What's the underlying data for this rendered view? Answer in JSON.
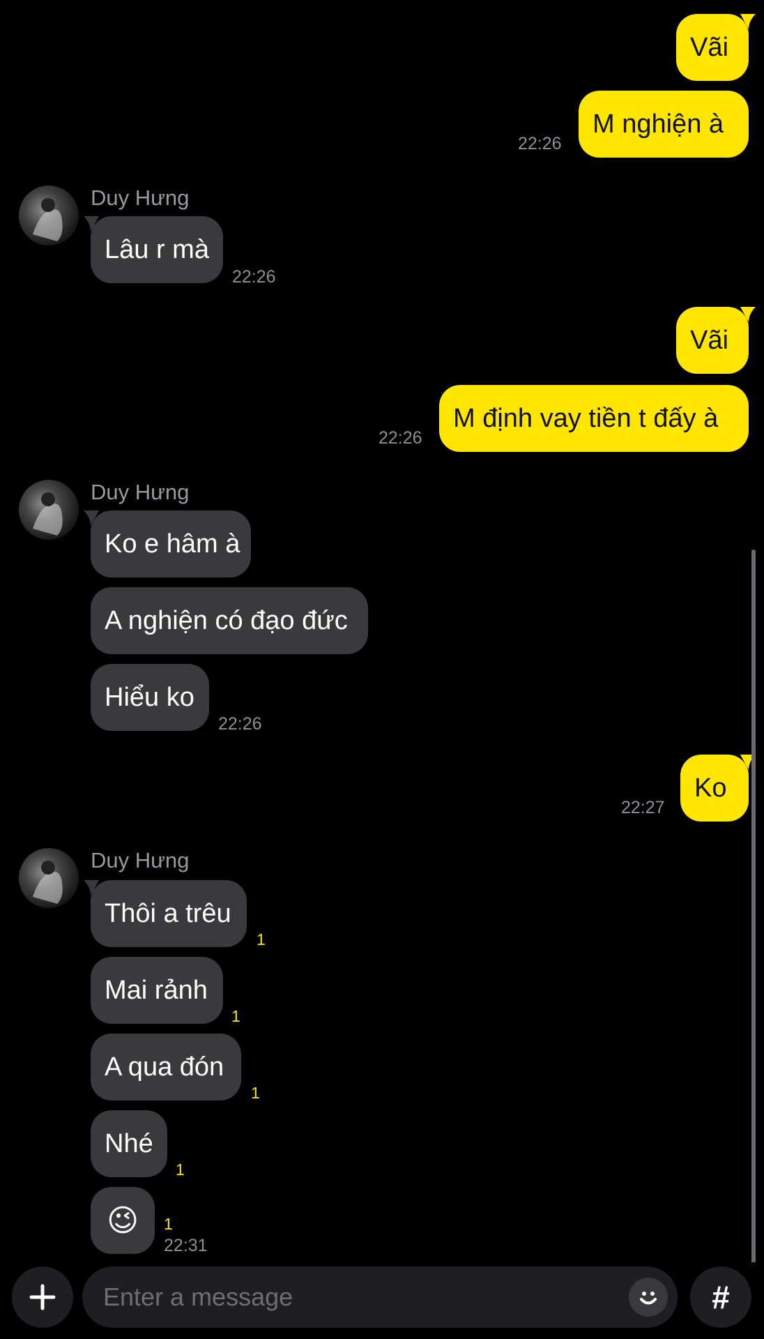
{
  "contact_name": "Duy Hưng",
  "messages": {
    "m1": "Vãi",
    "m2": "M nghiện à",
    "t1": "22:26",
    "m3": "Lâu r mà",
    "t2": "22:26",
    "m4": "Vãi",
    "m5": "M định vay tiền t đấy à",
    "t3": "22:26",
    "m6": "Ko e hâm à",
    "m7": "A nghiện có đạo đức",
    "m8": "Hiểu ko",
    "t4": "22:26",
    "m9": "Ko",
    "t5": "22:27",
    "m10": "Thôi a trêu",
    "m11": "Mai rảnh",
    "m12": "A qua đón",
    "m13": "Nhé",
    "m14": "😉",
    "t6": "22:31"
  },
  "unread_counts": {
    "u10": "1",
    "u11": "1",
    "u12": "1",
    "u13": "1",
    "u14": "1"
  },
  "composer": {
    "placeholder": "Enter a message",
    "hash_label": "#"
  },
  "colors": {
    "my_bubble": "#ffe600",
    "their_bubble": "#3a3a3c",
    "background": "#000000"
  },
  "icons": {
    "attach": "plus-icon",
    "emoji": "emoji-icon",
    "hashtag": "hash-icon"
  }
}
